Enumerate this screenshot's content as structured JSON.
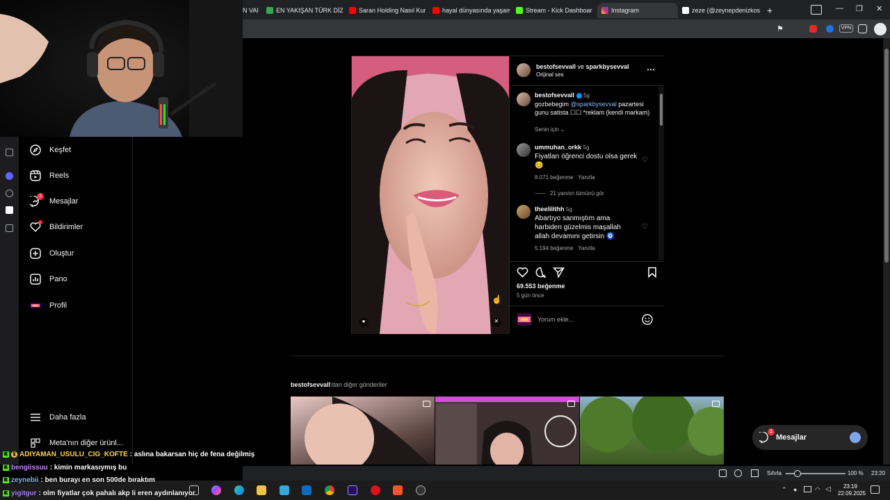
{
  "browser": {
    "tabs": [
      {
        "label": "N VAR",
        "color": "#d93025"
      },
      {
        "label": "EN YAKIŞAN TÜRK DİZİ Çİ",
        "color": "#34a853"
      },
      {
        "label": "Saran Holding Nasıl Kurukt",
        "color": "#ff0000"
      },
      {
        "label": "hayal dünyasında yaşaman",
        "color": "#ff0000"
      },
      {
        "label": "Stream - Kick Dashboard",
        "color": "#53fc18"
      },
      {
        "label": "Instagram",
        "color": "#e1306c",
        "badge": "1"
      },
      {
        "label": "zeze (@zeynepdenizkose) |",
        "color": "#ffffff"
      }
    ],
    "new_tab": "+",
    "vpn_label": "VPN"
  },
  "sidebar": {
    "items": [
      {
        "label": "Keşfet",
        "icon": "compass-icon"
      },
      {
        "label": "Reels",
        "icon": "reels-icon"
      },
      {
        "label": "Mesajlar",
        "icon": "messenger-icon",
        "badge": "1"
      },
      {
        "label": "Bildirimler",
        "icon": "heart-icon"
      },
      {
        "label": "Oluştur",
        "icon": "plus-square-icon"
      },
      {
        "label": "Pano",
        "icon": "dashboard-icon"
      },
      {
        "label": "Profil",
        "icon": "profile-avatar-icon"
      }
    ],
    "more": "Daha fazla",
    "meta": "Meta'nın diğer ürünl..."
  },
  "post": {
    "header_user1": "bestofsevvall",
    "header_and": " ve ",
    "header_user2": "sparkbysevval",
    "audio": "Orijinal ses",
    "caption_user": "bestofsevvall",
    "caption_time": "5g",
    "caption_pre": "gozbebegim ",
    "caption_mention": "@sparkbysevval",
    "caption_post": " pazartesi gunu satista ☐☐ *reklam (kendi markam)",
    "for_you": "Senin için",
    "comments": [
      {
        "user": "ummuhan_orkk",
        "time": "5g",
        "text": "Fiyatları öğrenci dostu olsa gerek 😊",
        "likes": "8.071 beğenme",
        "reply": "Yanıtla"
      },
      {
        "user": "theelilithh",
        "time": "5g",
        "text": "Abartıyo sanmıştım ama harbiden güzelmis maşallah allah devamını getirsin 🧿",
        "likes": "5.194 beğenme",
        "reply": "Yanıtla"
      }
    ],
    "view_replies": "21 yanıtın tümünü gör",
    "like_count": "69.553 beğenme",
    "posted": "5 gün önce",
    "comment_placeholder": "Yorum ekle..."
  },
  "more_posts": {
    "user": "bestofsevvall",
    "suffix": "'dan diğer gönderiler"
  },
  "messages_pill": {
    "label": "Mesajlar",
    "badge": "1"
  },
  "statusbar": {
    "reset": "Sıfırla",
    "zoom": "100 %",
    "time": "23:20"
  },
  "taskbar": {
    "time": "23:19",
    "date": "22.09.2025"
  },
  "chat": [
    {
      "user": "ADIYAMAN_USULU_CIG_KOFTE",
      "color": "#ffd23f",
      "text": ": aslına bakarsan hiç de fena değilmiş",
      "badge": "1"
    },
    {
      "user": "bengiissuu",
      "color": "#c586ff",
      "text": ": kimin markasıymış bu"
    },
    {
      "user": "zeynebii",
      "color": "#8ab4f8",
      "text": ": ben burayı en son 500de bıraktım"
    },
    {
      "user": "yigitgur",
      "color": "#b388ff",
      "text": ": olm fiyatlar çok pahalı akp li eren aydınlanıyor"
    }
  ]
}
